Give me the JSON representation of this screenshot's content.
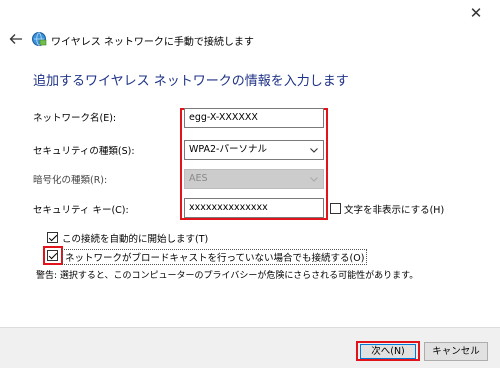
{
  "window": {
    "close_glyph": "✕",
    "title": "ワイヤレス ネットワークに手動で接続します"
  },
  "heading": "追加するワイヤレス ネットワークの情報を入力します",
  "fields": {
    "network_name": {
      "label": "ネットワーク名(E):",
      "value": "egg-X-XXXXXX"
    },
    "security_type": {
      "label": "セキュリティの種類(S):",
      "value": "WPA2-パーソナル"
    },
    "encryption_type": {
      "label": "暗号化の種類(R):",
      "value": "AES"
    },
    "security_key": {
      "label": "セキュリティ キー(C):",
      "value": "xxxxxxxxxxxxxx"
    }
  },
  "checkboxes": {
    "hide_chars": {
      "label": "文字を非表示にする(H)",
      "checked": false
    },
    "auto_start": {
      "label": "この接続を自動的に開始します(T)",
      "checked": true
    },
    "connect_no_broadcast": {
      "label": "ネットワークがブロードキャストを行っていない場合でも接続する(O)",
      "checked": true
    }
  },
  "warning": "警告: 選択すると、このコンピューターのプライバシーが危険にさらされる可能性があります。",
  "buttons": {
    "next": "次へ(N)",
    "cancel": "キャンセル"
  },
  "colors": {
    "heading": "#1e3287",
    "highlight": "#e2141b",
    "accent": "#0078d7"
  },
  "icons": {
    "back": "back-arrow-icon",
    "network": "wireless-network-icon",
    "close": "close-icon",
    "dropdown": "chevron-down-icon"
  }
}
